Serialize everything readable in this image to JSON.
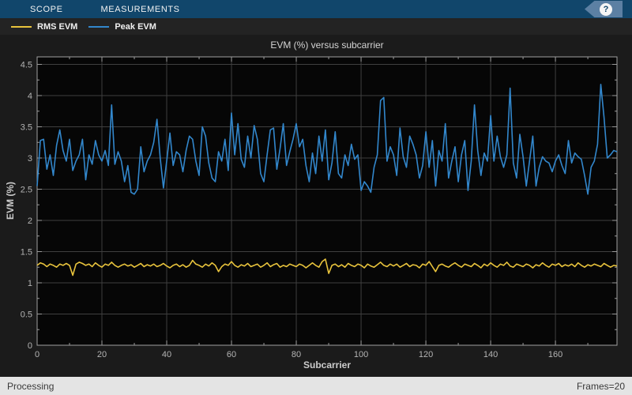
{
  "toolbar": {
    "tabs": [
      {
        "label": "SCOPE"
      },
      {
        "label": "MEASUREMENTS"
      }
    ],
    "help_label": "?"
  },
  "legend": [
    {
      "label": "RMS EVM",
      "color": "#e8c33c"
    },
    {
      "label": "Peak EVM",
      "color": "#3287cc"
    }
  ],
  "status_bar": {
    "left": "Processing",
    "right": "Frames=20"
  },
  "colors": {
    "toolbar_bg": "#11466b",
    "help_tag_bg": "#5c80a3",
    "panel_bg": "#1b1b1b",
    "legend_bg": "#232323",
    "plot_bg": "#060606",
    "grid": "#3f3f3f",
    "axis": "#a0a0a0",
    "tick": "#9a9a9a",
    "tick_label": "#b4b4b4",
    "status_bg": "#e4e4e4",
    "status_text": "#3a3a3a"
  },
  "chart_data": {
    "type": "line",
    "title": "EVM (%) versus subcarrier",
    "xlabel": "Subcarrier",
    "ylabel": "EVM (%)",
    "xlim": [
      0,
      179
    ],
    "ylim": [
      0,
      4.62
    ],
    "grid": true,
    "legend_position": "top-strip",
    "x_major_ticks": [
      0,
      20,
      40,
      60,
      80,
      100,
      120,
      140,
      160
    ],
    "x_minor_step": 10,
    "y_major_ticks": [
      0,
      0.5,
      1,
      1.5,
      2,
      2.5,
      3,
      3.5,
      4,
      4.5
    ],
    "y_minor_step": 0.25,
    "series": [
      {
        "name": "RMS EVM",
        "color": "#e8c33c",
        "values": [
          1.28,
          1.32,
          1.3,
          1.26,
          1.3,
          1.28,
          1.25,
          1.3,
          1.28,
          1.31,
          1.28,
          1.12,
          1.3,
          1.33,
          1.31,
          1.28,
          1.3,
          1.26,
          1.32,
          1.28,
          1.25,
          1.3,
          1.28,
          1.33,
          1.28,
          1.25,
          1.28,
          1.3,
          1.27,
          1.29,
          1.25,
          1.28,
          1.31,
          1.26,
          1.29,
          1.27,
          1.3,
          1.26,
          1.28,
          1.31,
          1.27,
          1.24,
          1.28,
          1.3,
          1.26,
          1.29,
          1.25,
          1.28,
          1.36,
          1.3,
          1.28,
          1.25,
          1.3,
          1.27,
          1.32,
          1.28,
          1.18,
          1.26,
          1.3,
          1.28,
          1.34,
          1.28,
          1.25,
          1.29,
          1.27,
          1.31,
          1.26,
          1.28,
          1.3,
          1.25,
          1.28,
          1.32,
          1.26,
          1.29,
          1.31,
          1.25,
          1.28,
          1.26,
          1.3,
          1.28,
          1.26,
          1.3,
          1.28,
          1.24,
          1.28,
          1.32,
          1.28,
          1.25,
          1.34,
          1.38,
          1.15,
          1.28,
          1.3,
          1.26,
          1.29,
          1.25,
          1.31,
          1.28,
          1.26,
          1.3,
          1.28,
          1.24,
          1.3,
          1.27,
          1.25,
          1.29,
          1.33,
          1.28,
          1.26,
          1.3,
          1.27,
          1.3,
          1.25,
          1.28,
          1.31,
          1.26,
          1.29,
          1.28,
          1.24,
          1.3,
          1.28,
          1.34,
          1.26,
          1.18,
          1.28,
          1.3,
          1.27,
          1.25,
          1.29,
          1.32,
          1.28,
          1.25,
          1.3,
          1.28,
          1.26,
          1.31,
          1.28,
          1.24,
          1.3,
          1.27,
          1.32,
          1.28,
          1.25,
          1.3,
          1.28,
          1.33,
          1.27,
          1.25,
          1.3,
          1.28,
          1.26,
          1.3,
          1.28,
          1.24,
          1.29,
          1.27,
          1.32,
          1.28,
          1.25,
          1.3,
          1.28,
          1.31,
          1.26,
          1.29,
          1.27,
          1.3,
          1.26,
          1.32,
          1.28,
          1.25,
          1.29,
          1.27,
          1.3,
          1.28,
          1.26,
          1.31,
          1.28,
          1.25,
          1.28,
          1.27
        ]
      },
      {
        "name": "Peak EVM",
        "color": "#3287cc",
        "values": [
          2.55,
          3.28,
          3.3,
          2.82,
          3.05,
          2.72,
          3.2,
          3.45,
          3.12,
          2.95,
          3.3,
          2.8,
          2.95,
          3.05,
          3.3,
          2.65,
          3.05,
          2.9,
          3.28,
          3.05,
          2.95,
          3.12,
          2.88,
          3.85,
          2.9,
          3.1,
          2.95,
          2.62,
          2.88,
          2.45,
          2.42,
          2.5,
          3.18,
          2.78,
          2.95,
          3.05,
          3.25,
          3.62,
          3.0,
          2.52,
          2.95,
          3.4,
          2.88,
          3.1,
          3.05,
          2.78,
          3.12,
          3.35,
          3.3,
          2.95,
          2.72,
          3.5,
          3.35,
          2.92,
          2.68,
          2.62,
          3.1,
          2.95,
          3.3,
          2.8,
          3.72,
          3.05,
          3.55,
          2.98,
          2.85,
          3.35,
          3.0,
          3.52,
          3.3,
          2.75,
          2.62,
          3.05,
          3.45,
          3.48,
          2.82,
          3.15,
          3.55,
          2.88,
          3.1,
          3.3,
          3.55,
          3.18,
          3.3,
          2.88,
          2.62,
          3.08,
          2.75,
          3.35,
          2.95,
          3.45,
          2.65,
          2.92,
          3.42,
          2.75,
          2.68,
          3.05,
          2.88,
          3.22,
          2.98,
          3.05,
          2.48,
          2.62,
          2.55,
          2.45,
          2.85,
          3.05,
          3.92,
          3.97,
          2.95,
          3.18,
          3.05,
          2.72,
          3.48,
          3.02,
          2.85,
          3.35,
          3.22,
          3.05,
          2.68,
          2.88,
          3.42,
          2.85,
          3.28,
          2.55,
          3.12,
          2.95,
          3.55,
          2.68,
          2.95,
          3.18,
          2.62,
          3.05,
          3.28,
          2.48,
          2.95,
          3.85,
          3.12,
          2.72,
          3.08,
          2.95,
          3.68,
          2.95,
          3.35,
          3.02,
          2.85,
          3.05,
          4.12,
          2.92,
          2.68,
          3.38,
          3.02,
          2.55,
          2.95,
          3.35,
          2.55,
          2.85,
          3.02,
          2.95,
          2.92,
          2.78,
          2.95,
          3.05,
          2.88,
          2.75,
          3.28,
          2.92,
          3.08,
          3.02,
          2.98,
          2.72,
          2.42,
          2.85,
          2.95,
          3.22,
          4.18,
          3.65,
          3.0,
          3.05,
          3.12,
          3.1
        ]
      }
    ]
  }
}
